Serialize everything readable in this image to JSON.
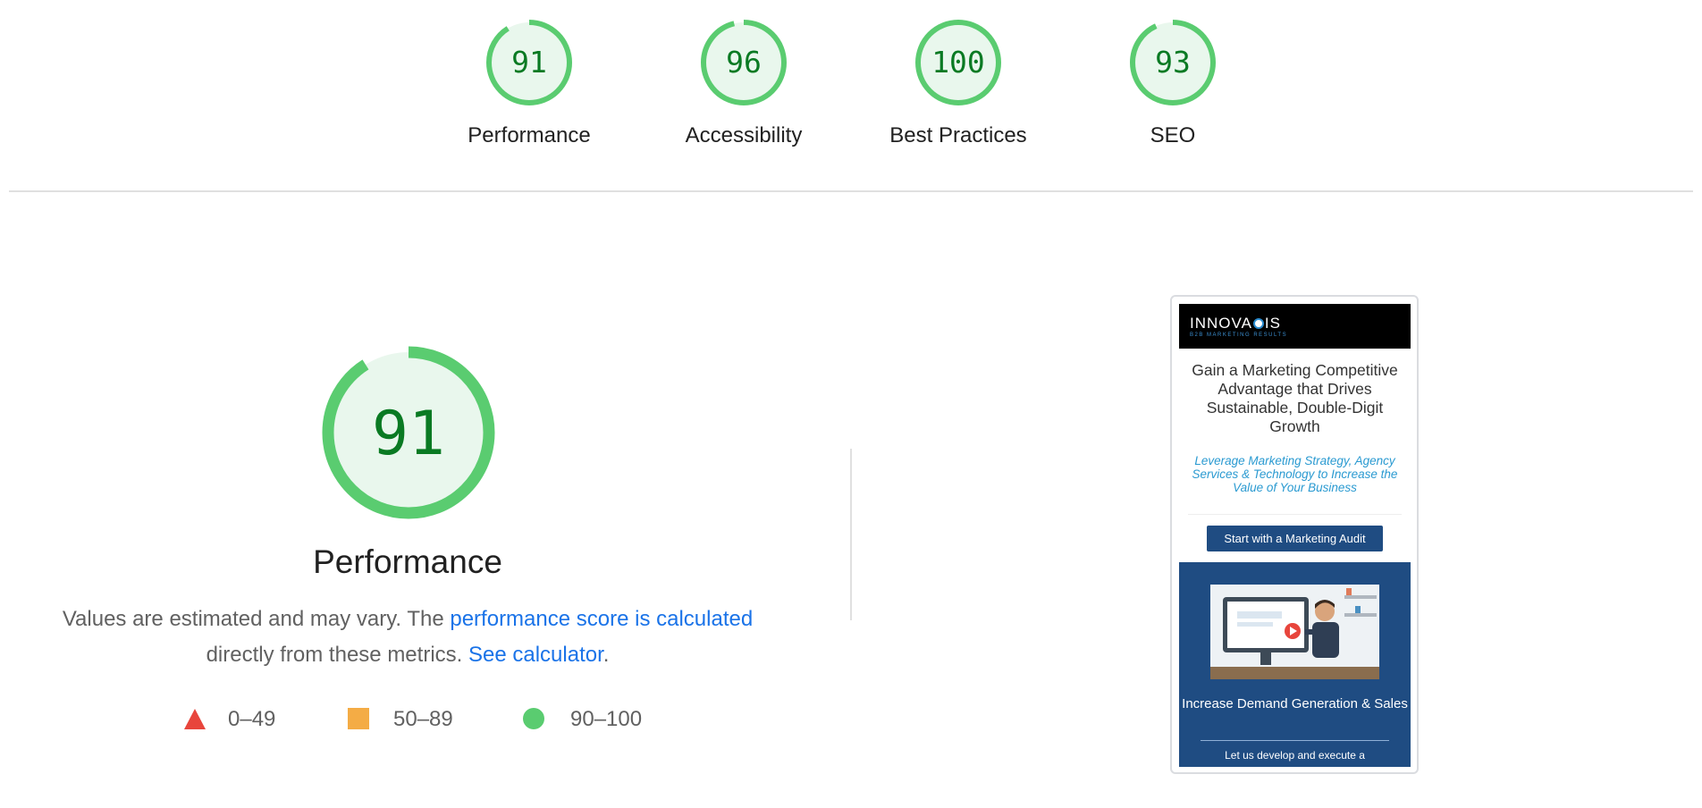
{
  "scores": [
    {
      "value": 91,
      "label": "Performance"
    },
    {
      "value": 96,
      "label": "Accessibility"
    },
    {
      "value": 100,
      "label": "Best Practices"
    },
    {
      "value": 93,
      "label": "SEO"
    }
  ],
  "performance": {
    "score": 91,
    "title": "Performance",
    "desc_prefix": "Values are estimated and may vary. The ",
    "desc_link": "performance score is calculated",
    "desc_middle": " directly from these metrics. ",
    "calc_link": "See calculator",
    "desc_suffix": ".",
    "legend": [
      {
        "range": "0–49",
        "shape": "triangle",
        "color": "#e8453c"
      },
      {
        "range": "50–89",
        "shape": "square",
        "color": "#f4ac45"
      },
      {
        "range": "90–100",
        "shape": "circle",
        "color": "#5acc70"
      }
    ]
  },
  "colors": {
    "pass": "#5acc70",
    "pass_fill": "#e9f7ed",
    "pass_text": "#0a7a23",
    "link": "#1a73e8"
  },
  "thumbnail": {
    "logo_left": "INNOVA",
    "logo_right": "IS",
    "logo_sub": "B2B MARKETING RESULTS",
    "headline": "Gain a Marketing Competitive Advantage that Drives Sustainable, Double-Digit Growth",
    "subhead": "Leverage Marketing Strategy, Agency Services & Technology to Increase the Value of Your Business",
    "cta": "Start with a Marketing Audit",
    "section_title": "Increase Demand Generation & Sales",
    "section_text": "Let us develop and execute a"
  }
}
